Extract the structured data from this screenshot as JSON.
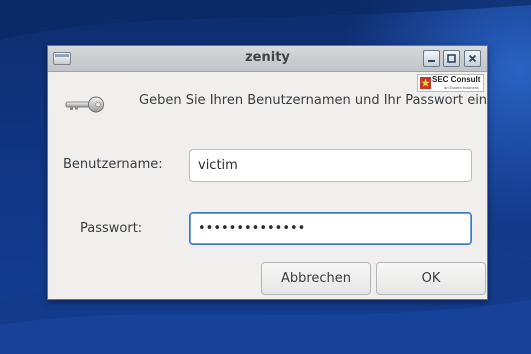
{
  "window": {
    "title": "zenity",
    "prompt": "Geben Sie Ihren Benutzernamen und Ihr Passwort ein"
  },
  "badge": {
    "name": "SEC Consult",
    "sub": "an Eviden business"
  },
  "form": {
    "username_label": "Benutzername:",
    "username_value": "victim",
    "password_label": "Passwort:",
    "password_value": "••••••••••••••"
  },
  "buttons": {
    "cancel_label": "Abbrechen",
    "ok_label": "OK"
  },
  "colors": {
    "desktop": "#0f3582",
    "focus_border": "#3b78c4",
    "dialog_bg": "#f0efee"
  },
  "icons": {
    "window_menu": "window-menu-icon",
    "minimize": "minimize-icon",
    "maximize": "maximize-icon",
    "close": "close-icon",
    "key": "key-icon",
    "logo": "sec-consult-logo"
  }
}
